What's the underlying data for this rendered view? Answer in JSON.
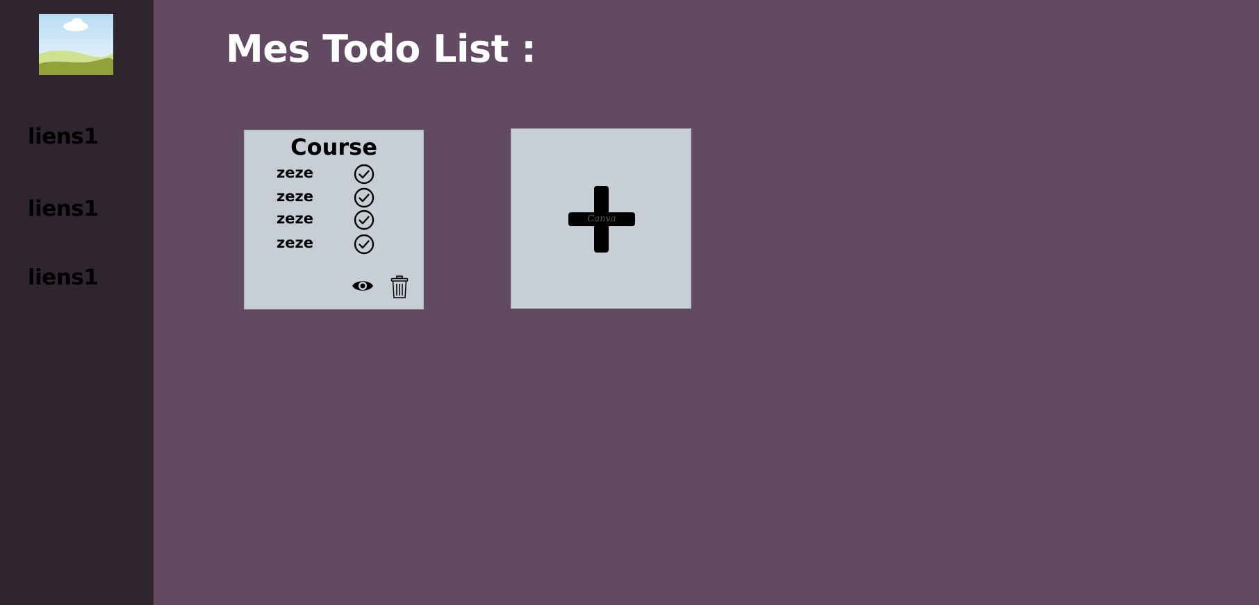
{
  "page": {
    "title": "Mes Todo List :"
  },
  "sidebar": {
    "logo_icon": "image-placeholder-icon",
    "links": [
      {
        "label": "liens1"
      },
      {
        "label": "liens1"
      },
      {
        "label": "liens1"
      }
    ]
  },
  "todo_lists": [
    {
      "title": "Course",
      "items": [
        {
          "label": "zeze",
          "done": true
        },
        {
          "label": "zeze",
          "done": true
        },
        {
          "label": "zeze",
          "done": true
        },
        {
          "label": "zeze",
          "done": true
        }
      ],
      "actions": {
        "view_icon": "eye-icon",
        "delete_icon": "trash-icon"
      }
    }
  ],
  "add_list": {
    "icon": "plus-icon",
    "watermark": "Canva"
  },
  "colors": {
    "background": "#634a63",
    "sidebar": "#2f252f",
    "card": "#c8ced6",
    "title_text": "#ffffff"
  }
}
